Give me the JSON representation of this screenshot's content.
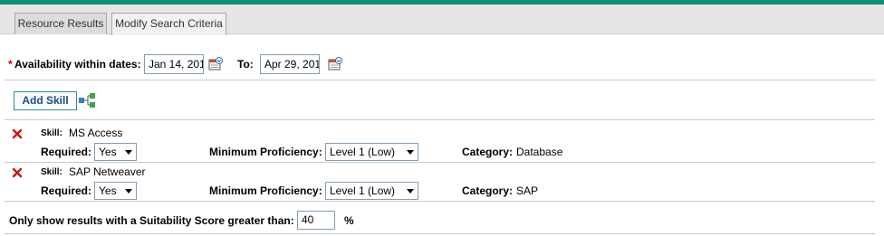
{
  "tabs": [
    {
      "label": "Resource Results"
    },
    {
      "label": "Modify Search Criteria"
    }
  ],
  "availability": {
    "required_marker": "*",
    "label": "Availability within dates:",
    "from_value": "Jan 14, 201",
    "to_label": "To:",
    "to_value": "Apr 29, 201"
  },
  "add_skill": {
    "label": "Add Skill"
  },
  "skills": [
    {
      "skill_label": "Skill:",
      "skill_name": "MS Access",
      "required_label": "Required:",
      "required_value": "Yes",
      "proficiency_label": "Minimum Proficiency:",
      "proficiency_value": "Level 1 (Low)",
      "category_label": "Category:",
      "category_value": "Database"
    },
    {
      "skill_label": "Skill:",
      "skill_name": "SAP Netweaver",
      "required_label": "Required:",
      "required_value": "Yes",
      "proficiency_label": "Minimum Proficiency:",
      "proficiency_value": "Level 1 (Low)",
      "category_label": "Category:",
      "category_value": "SAP"
    }
  ],
  "suitability": {
    "label": "Only show results with a Suitability Score greater than:",
    "value": "40",
    "unit": "%"
  },
  "colors": {
    "accent_bar": "#0e8f78",
    "required_marker": "#d00000",
    "delete_icon": "#cc1111"
  }
}
